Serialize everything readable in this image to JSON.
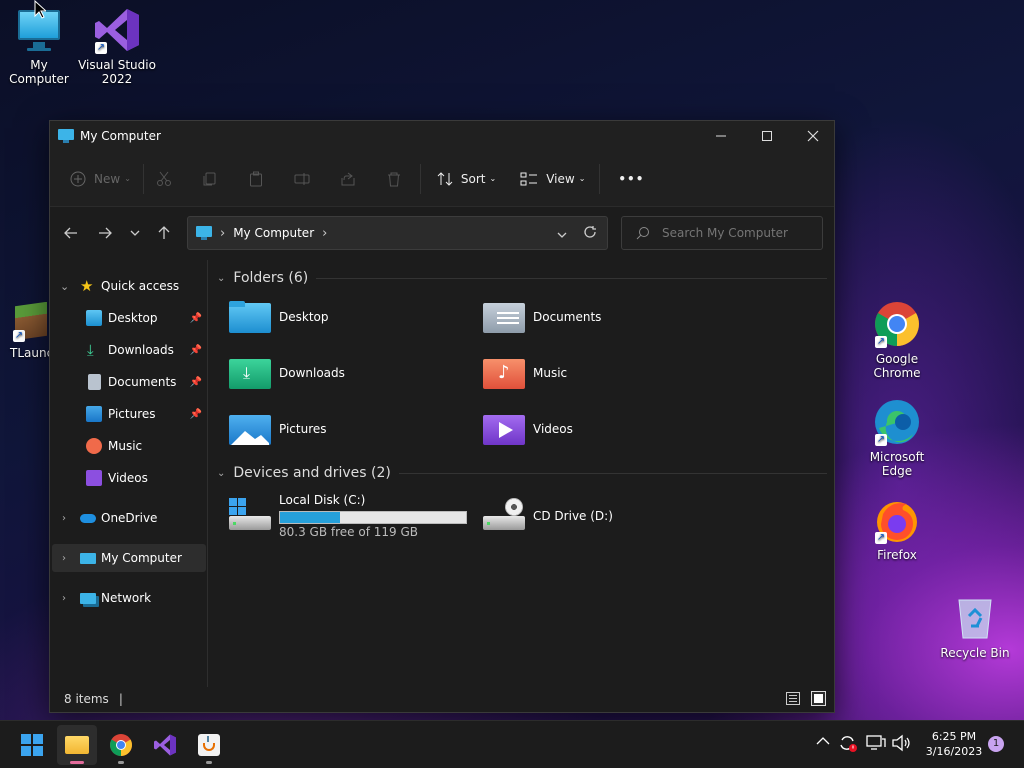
{
  "desktop": {
    "icons": [
      {
        "label": "My Computer",
        "icon": "monitor-icon"
      },
      {
        "label": "Visual Studio 2022",
        "icon": "visual-studio-icon"
      },
      {
        "label": "TLaunc",
        "icon": "minecraft-grass-icon"
      },
      {
        "label": "Google Chrome",
        "icon": "chrome-icon"
      },
      {
        "label": "Microsoft Edge",
        "icon": "edge-icon"
      },
      {
        "label": "Firefox",
        "icon": "firefox-icon"
      },
      {
        "label": "Recycle Bin",
        "icon": "recycle-bin-icon"
      }
    ]
  },
  "window": {
    "title": "My Computer",
    "toolbar": {
      "new_label": "New",
      "sort_label": "Sort",
      "view_label": "View",
      "more_label": "•••"
    },
    "address": {
      "separator": "›",
      "location": "My Computer"
    },
    "search": {
      "placeholder": "Search My Computer"
    },
    "sidebar": {
      "quick_access": "Quick access",
      "items": [
        {
          "label": "Desktop",
          "pinned": true
        },
        {
          "label": "Downloads",
          "pinned": true
        },
        {
          "label": "Documents",
          "pinned": true
        },
        {
          "label": "Pictures",
          "pinned": true
        },
        {
          "label": "Music",
          "pinned": false
        },
        {
          "label": "Videos",
          "pinned": false
        }
      ],
      "onedrive": "OneDrive",
      "my_computer": "My Computer",
      "network": "Network"
    },
    "folders_header": "Folders (6)",
    "folders": [
      {
        "label": "Desktop"
      },
      {
        "label": "Documents"
      },
      {
        "label": "Downloads"
      },
      {
        "label": "Music"
      },
      {
        "label": "Pictures"
      },
      {
        "label": "Videos"
      }
    ],
    "drives_header": "Devices and drives (2)",
    "drives": [
      {
        "label": "Local Disk (C:)",
        "free": "80.3 GB free of 119 GB",
        "used_fraction": 0.325
      },
      {
        "label": "CD Drive (D:)"
      }
    ],
    "status": {
      "items": "8 items",
      "caret": "|"
    }
  },
  "taskbar": {
    "time": "6:25 PM",
    "date": "3/16/2023",
    "notification_count": "1"
  },
  "colors": {
    "accent": "#0078d4",
    "drive_bar_used": "#26a0da",
    "window_bg": "#1c1c1c"
  }
}
